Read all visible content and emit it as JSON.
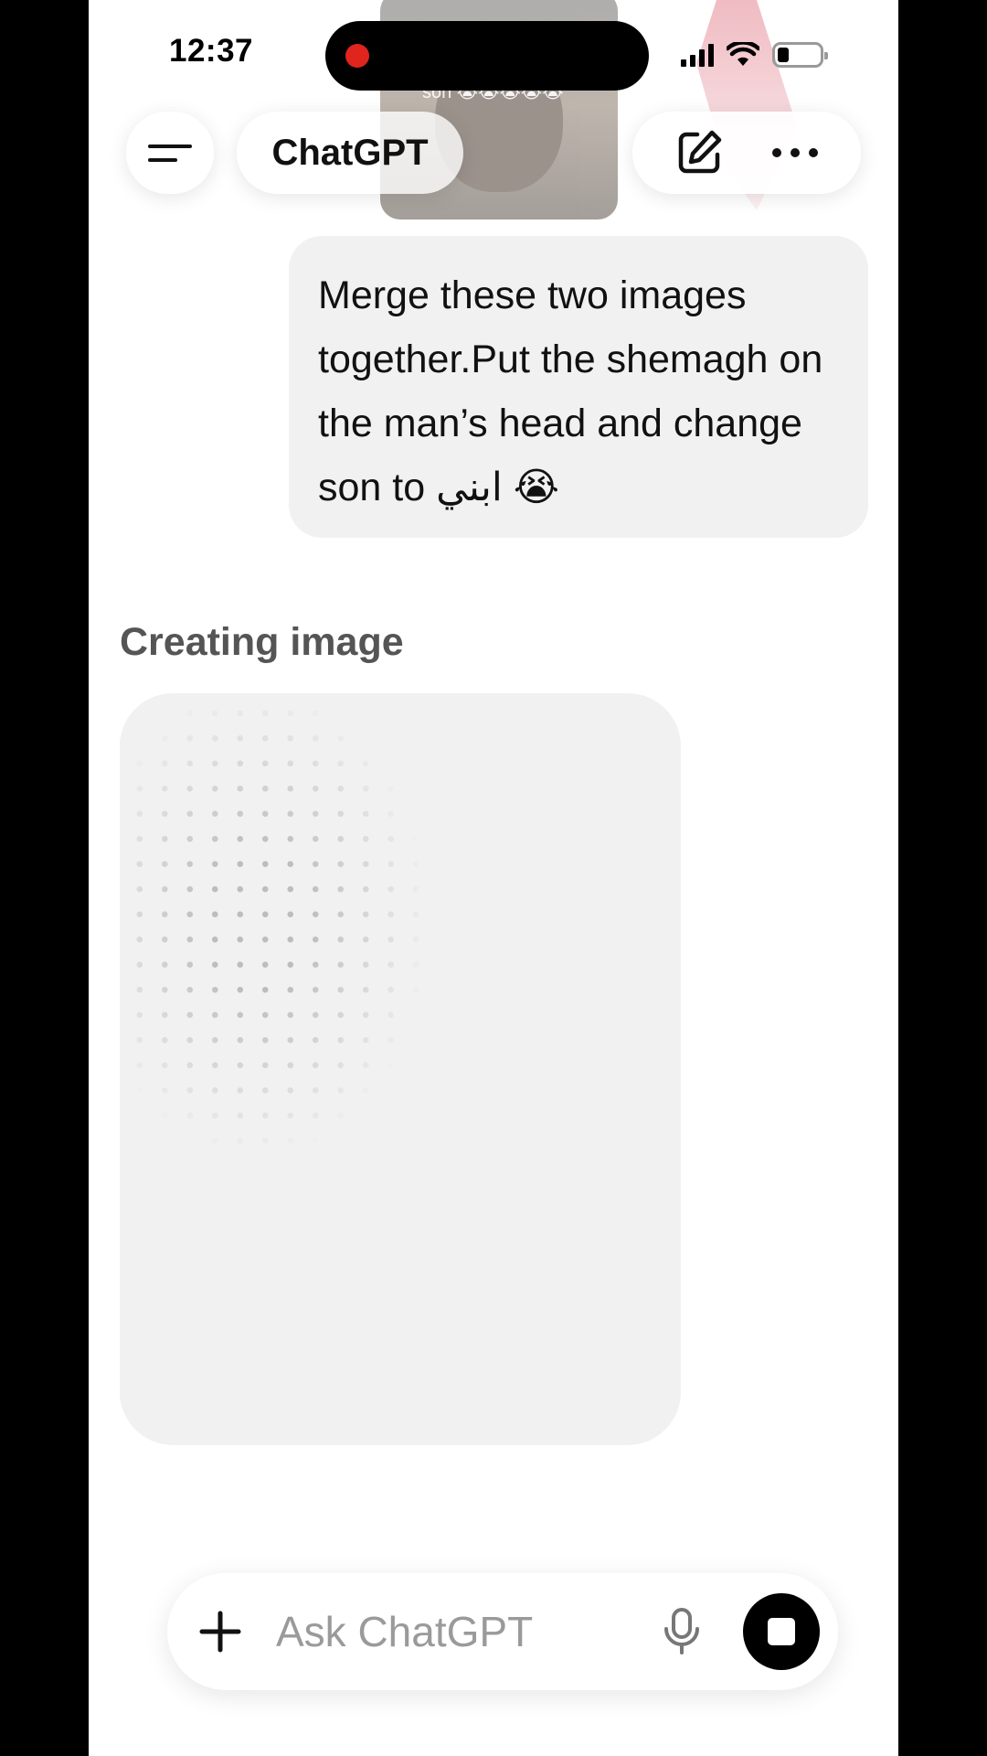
{
  "status_bar": {
    "time": "12:37",
    "recording": true,
    "icons": [
      "signal-icon",
      "wifi-icon",
      "battery-icon"
    ],
    "battery_level": 0.2
  },
  "background_preview": {
    "caption": "son 😭😭😭😭😭"
  },
  "header": {
    "title": "ChatGPT",
    "menu_icon": "hamburger-icon",
    "new_chat_icon": "edit-icon",
    "more_icon": "more-icon"
  },
  "conversation": {
    "user_message": "Merge these two images together.Put the shemagh on the man’s head and change son to ابني 😭",
    "assistant_status": "Creating image"
  },
  "composer": {
    "placeholder": "Ask ChatGPT",
    "add_icon": "plus-icon",
    "mic_icon": "mic-icon",
    "stop_icon": "stop-icon"
  },
  "colors": {
    "bubble": "#f1f1f1",
    "placeholder_text": "#9a9a9a",
    "recording_dot": "#e0241e"
  }
}
